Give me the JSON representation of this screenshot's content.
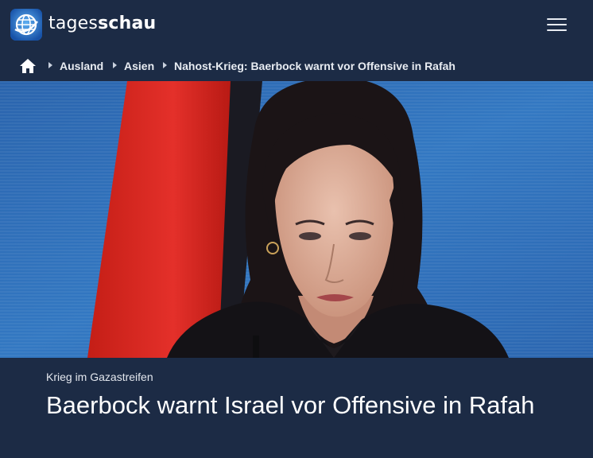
{
  "brand": {
    "light": "tages",
    "bold": "schau"
  },
  "breadcrumb": {
    "items": [
      "Ausland",
      "Asien",
      "Nahost-Krieg: Baerbock warnt vor Offensive in Rafah"
    ]
  },
  "article": {
    "kicker": "Krieg im Gazastreifen",
    "headline": "Baerbock warnt Israel vor Offensive in Rafah"
  },
  "colors": {
    "background": "#1c2b45",
    "logo_blue": "#1b5fb5",
    "flag_red": "#d8261c",
    "backdrop_blue": "#2e6fb6"
  },
  "icons": {
    "logo": "tagesschau-globe-icon",
    "menu": "hamburger-menu-icon",
    "home": "home-icon",
    "separator": "chevron-right-icon"
  }
}
